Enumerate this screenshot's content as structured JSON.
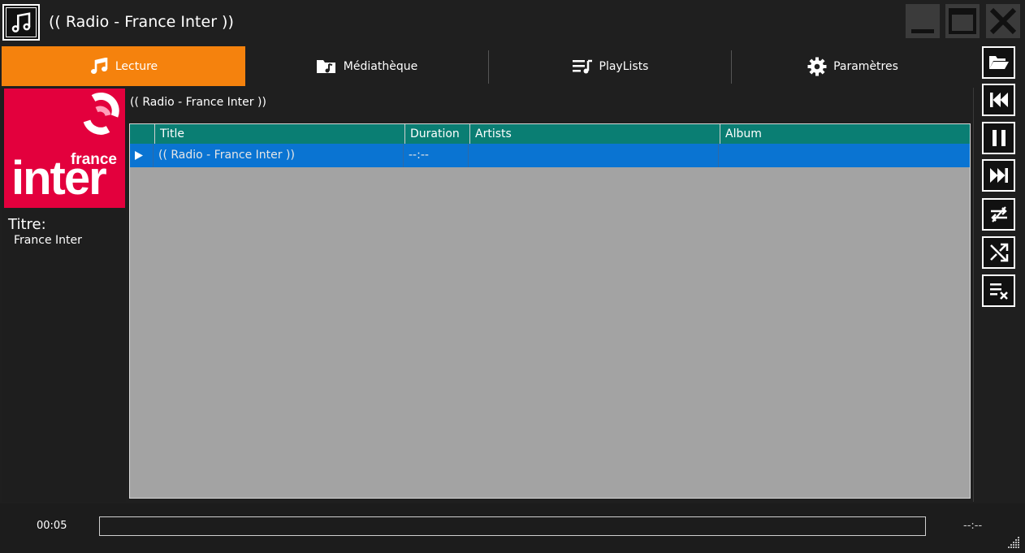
{
  "window": {
    "title": "(( Radio - France Inter ))",
    "icons": [
      "music-note-icon",
      "minimize-icon",
      "maximize-icon",
      "close-icon"
    ]
  },
  "tabs": [
    {
      "label": "Lecture",
      "icon": "music-note-icon",
      "active": true
    },
    {
      "label": "Médiathèque",
      "icon": "folder-music-icon",
      "active": false
    },
    {
      "label": "PlayLists",
      "icon": "playlist-icon",
      "active": false
    },
    {
      "label": "Paramètres",
      "icon": "gear-icon",
      "active": false
    }
  ],
  "now_playing": {
    "cover_logo_text_small": "france",
    "cover_logo_text_big": "inter",
    "title_label": "Titre:",
    "title_value": "France Inter"
  },
  "playlist": {
    "name": "(( Radio - France Inter ))",
    "columns": [
      "Title",
      "Duration",
      "Artists",
      "Album"
    ],
    "rows": [
      {
        "playing": true,
        "title": "(( Radio - France Inter ))",
        "duration": "--:--",
        "artists": "",
        "album": ""
      }
    ]
  },
  "controls": [
    "open-folder-icon",
    "previous-icon",
    "pause-icon",
    "next-icon",
    "repeat-icon",
    "shuffle-icon",
    "clear-playlist-icon"
  ],
  "transport": {
    "current_time": "00:05",
    "total_time": "--:--",
    "progress": 0
  },
  "colors": {
    "accent_tab": "#f5820d",
    "header": "#0a7e73",
    "selected_row": "#0a74d2",
    "cover_bg": "#e3003d"
  }
}
